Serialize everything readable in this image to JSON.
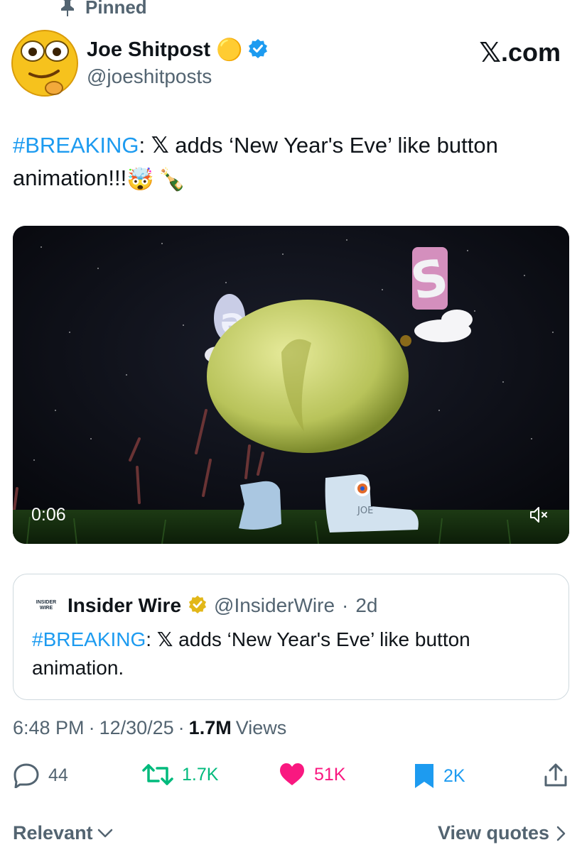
{
  "pinned": {
    "label": "Pinned",
    "icon": "pin-icon"
  },
  "author": {
    "name": "Joe Shitpost",
    "handle": "@joeshitposts",
    "verified": true,
    "badge_emoji": "🟡"
  },
  "brand": {
    "x": "𝕏",
    "suffix": ".com"
  },
  "tweet": {
    "hashtag": "#BREAKING",
    "colon": ":",
    "x_glyph": "𝕏",
    "line1": " adds ‘New Year's Eve’ like button",
    "line2": "animation!!!",
    "emoji1": "🤯",
    "emoji2": "🍾"
  },
  "media": {
    "type": "video",
    "duration": "0:06",
    "muted": true,
    "shoe_label": "JOE"
  },
  "quote": {
    "logo_top": "INSIDER",
    "logo_bottom": "WIRE",
    "name": "Insider Wire",
    "handle": "@InsiderWire",
    "time": "2d",
    "hashtag": "#BREAKING",
    "colon": ":",
    "x_glyph": "𝕏",
    "line1": " adds ‘New Year's Eve’ like button",
    "line2": "animation."
  },
  "meta": {
    "time": "6:48 PM",
    "date": "12/30/25",
    "views_count": "1.7M",
    "views_label": "Views",
    "sep": "·"
  },
  "actions": {
    "replies": "44",
    "reposts": "1.7K",
    "likes": "51K",
    "bookmarks": "2K"
  },
  "footer": {
    "sort": "Relevant",
    "view_quotes": "View quotes"
  },
  "colors": {
    "accent": "#1d9bf0",
    "repost": "#00ba7c",
    "like": "#f91880",
    "muted_text": "#536471"
  }
}
